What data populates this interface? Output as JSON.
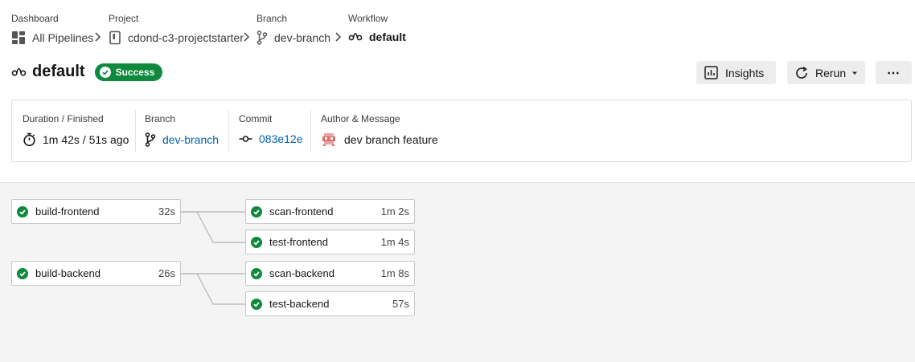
{
  "breadcrumbs": [
    {
      "label": "Dashboard",
      "value": "All Pipelines",
      "icon": "dashboard-icon"
    },
    {
      "label": "Project",
      "value": "cdond-c3-projectstarter",
      "icon": "repo-icon"
    },
    {
      "label": "Branch",
      "value": "dev-branch",
      "icon": "branch-icon"
    },
    {
      "label": "Workflow",
      "value": "default",
      "icon": "workflow-icon"
    }
  ],
  "header": {
    "title": "default",
    "status": "Success",
    "status_color": "#0f8a3c"
  },
  "actions": {
    "insights_label": "Insights",
    "rerun_label": "Rerun",
    "more_label": "⋯"
  },
  "summary": {
    "duration": {
      "label": "Duration / Finished",
      "value": "1m 42s / 51s ago"
    },
    "branch": {
      "label": "Branch",
      "value": "dev-branch"
    },
    "commit": {
      "label": "Commit",
      "value": "083e12e"
    },
    "author": {
      "label": "Author & Message",
      "value": "dev branch feature"
    }
  },
  "jobs": {
    "build_frontend": {
      "name": "build-frontend",
      "duration": "32s"
    },
    "scan_frontend": {
      "name": "scan-frontend",
      "duration": "1m 2s"
    },
    "test_frontend": {
      "name": "test-frontend",
      "duration": "1m 4s"
    },
    "build_backend": {
      "name": "build-backend",
      "duration": "26s"
    },
    "scan_backend": {
      "name": "scan-backend",
      "duration": "1m 8s"
    },
    "test_backend": {
      "name": "test-backend",
      "duration": "57s"
    }
  },
  "colors": {
    "success": "#0f8a3c",
    "link": "#0062b1",
    "button_bg": "#ededed"
  }
}
